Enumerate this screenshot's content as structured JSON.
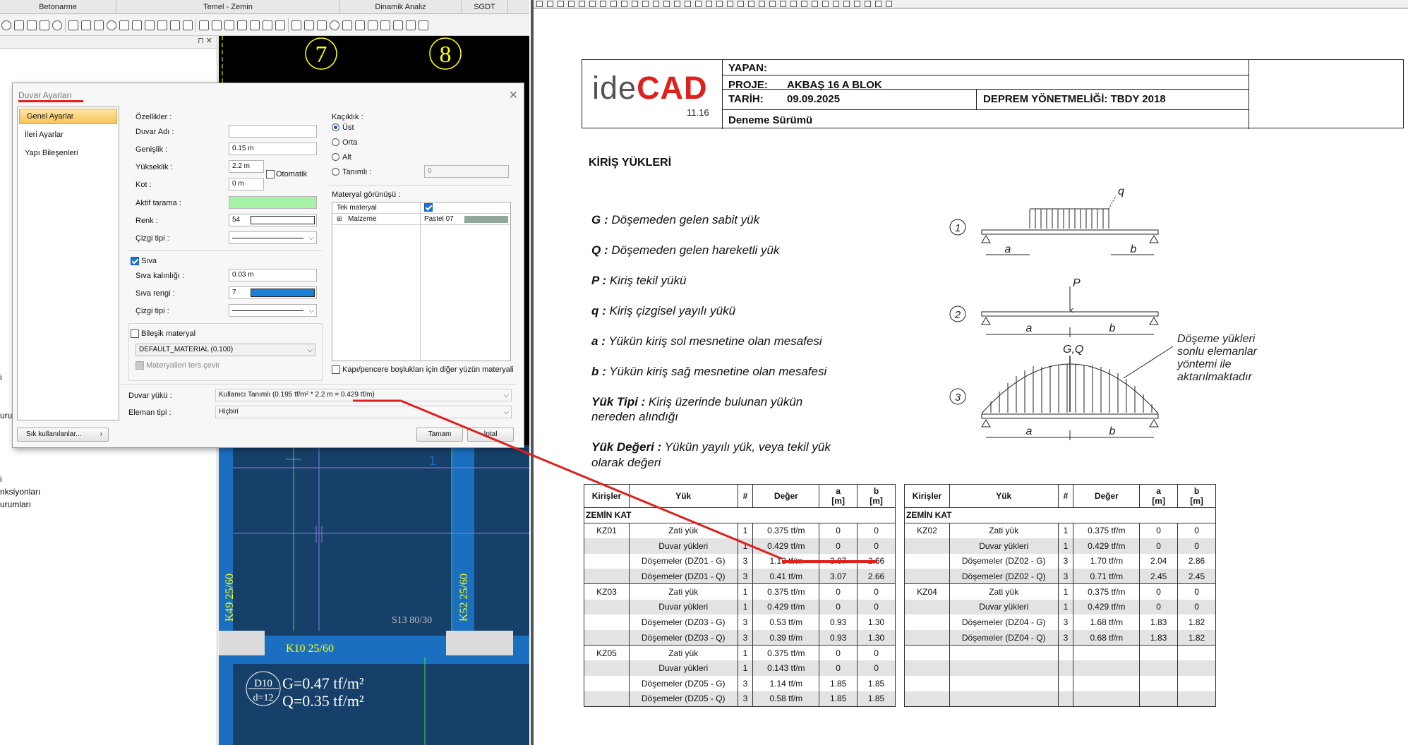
{
  "ribbon": {
    "tabs": [
      "Betonarme",
      "Temel - Zemin",
      "Dinamik Analiz",
      "SGDT"
    ]
  },
  "side_panel": {
    "header_icons": "⊓ ✕",
    "fragments": [
      "i",
      "urun",
      "i",
      "nksiyonları",
      "urumları"
    ]
  },
  "cad": {
    "axis_labels": [
      "7",
      "8"
    ],
    "beam_label": "K10  25/60",
    "column_left_label": "K49  25/60",
    "column_right_label": "K52  25/60",
    "column_label": "S13 80/30",
    "slab_id": "D10",
    "slab_thickness": "d=12",
    "slab_g": "G=0.47 tf/m²",
    "slab_q": "Q=0.35 tf/m²",
    "grid_number": "1"
  },
  "dialog": {
    "title": "Duvar Ayarları",
    "close": "✕",
    "nav": [
      "Genel Ayarlar",
      "İleri Ayarlar",
      "Yapı Bileşenleri"
    ],
    "active_nav": "Genel Ayarlar",
    "ozellikler_label": "Özellikler :",
    "duvar_adi_label": "Duvar Adı :",
    "duvar_adi_value": "",
    "genislik_label": "Genişlik :",
    "genislik_value": "0.15 m",
    "yukseklik_label": "Yükseklik :",
    "yukseklik_value": "2.2 m",
    "otomatik_label": "Otomatik",
    "kot_label": "Kot :",
    "kot_value": "0 m",
    "aktif_tarama_label": "Aktif tarama :",
    "renk_label": "Renk :",
    "renk_value": "54",
    "cizgi_tipi_label": "Çizgi tipi :",
    "siva_label": "Sıva",
    "siva_kalinligi_label": "Sıva kalınlığı :",
    "siva_kalinligi_value": "0.03 m",
    "siva_rengi_label": "Sıva rengi :",
    "siva_rengi_value": "7",
    "siva_cizgi_label": "Çizgi tipi :",
    "bilesik_label": "Bileşik materyal",
    "bilesik_value": "DEFAULT_MATERIAL (0.100)",
    "ters_cevir_label": "Materyalleri ters çevir",
    "kacklik_label": "Kaçıklık :",
    "kacklik_options": [
      "Üst",
      "Orta",
      "Alt",
      "Tanımlı :"
    ],
    "kacklik_selected": "Üst",
    "tanimli_value": "0",
    "materyal_gorunusu_label": "Materyal görünüşü :",
    "tek_materyal_label": "Tek materyal",
    "malzeme_label": "Malzeme",
    "malzeme_value": "Pastel 07",
    "kapi_label": "Kapı/pencere boşlukları için diğer yüzün materyali",
    "duvar_yuku_label": "Duvar yükü :",
    "duvar_yuku_value": "Kullanıcı Tanımlı (0.195 tf/m² * 2.2 m = 0.429 tf/m)",
    "eleman_tipi_label": "Eleman tipi :",
    "eleman_tipi_value": "Hiçbiri",
    "sik_button": "Sık kullanılanlar...",
    "ok_button": "Tamam",
    "cancel_button": "İptal",
    "colors": {
      "aktif_tarama": "#a6f3a6",
      "siva_rengi": "#1a7fd8"
    }
  },
  "report": {
    "logo_ide": "ide",
    "logo_cad": "CAD",
    "logo_version": "11.16",
    "yapan": "YAPAN:",
    "proje_label": "PROJE:",
    "proje_value": "AKBAŞ 16 A  BLOK",
    "tarih_label": "TARİH:",
    "tarih_value": "09.09.2025",
    "deprem": "DEPREM YÖNETMELİĞİ: TBDY 2018",
    "surum": "Deneme Sürümü",
    "section_title": "KİRİŞ YÜKLERİ",
    "legend": [
      {
        "key": "G :",
        "text": " Döşemeden gelen sabit yük"
      },
      {
        "key": "Q :",
        "text": " Döşemeden gelen hareketli yük"
      },
      {
        "key": "P :",
        "text": " Kiriş tekil yükü"
      },
      {
        "key": "q :",
        "text": " Kiriş çizgisel yayılı yükü"
      },
      {
        "key": "a :",
        "text": " Yükün kiriş sol mesnetine olan mesafesi"
      },
      {
        "key": "b :",
        "text": " Yükün kiriş sağ mesnetine olan mesafesi"
      },
      {
        "key": "Yük Tipi :",
        "text": " Kiriş üzerinde bulunan yükün"
      },
      {
        "key": "",
        "text": "nereden alındığı"
      },
      {
        "key": "Yük Değeri :",
        "text": " Yükün yayılı yük, veya tekil yük"
      },
      {
        "key": "",
        "text": "olarak değeri"
      }
    ],
    "diagram": {
      "labels": [
        "q",
        "a",
        "b",
        "P",
        "a",
        "b",
        "G,Q",
        "a",
        "b"
      ],
      "numbers": [
        "1",
        "2",
        "3"
      ],
      "note": [
        "Döşeme yükleri",
        "sonlu elemanlar",
        "yöntemi ile",
        "aktarılmaktadır"
      ]
    },
    "table_headers": [
      "Kirişler",
      "Yük",
      "#",
      "Değer",
      "a",
      "b"
    ],
    "table_units": [
      "",
      "",
      "",
      "",
      "[m]",
      "[m]"
    ],
    "floor": "ZEMİN KAT",
    "left_table": [
      {
        "beam": "KZ01",
        "rows": [
          [
            "Zati yük",
            "1",
            "0.375 tf/m",
            "0",
            "0"
          ],
          [
            "Duvar yükleri",
            "1",
            "0.429 tf/m",
            "0",
            "0"
          ],
          [
            "Döşemeler (DZ01 - G)",
            "3",
            "1.13 tf/m",
            "3.07",
            "2.66"
          ],
          [
            "Döşemeler (DZ01 - Q)",
            "3",
            "0.41 tf/m",
            "3.07",
            "2.66"
          ]
        ]
      },
      {
        "beam": "KZ03",
        "rows": [
          [
            "Zati yük",
            "1",
            "0.375 tf/m",
            "0",
            "0"
          ],
          [
            "Duvar yükleri",
            "1",
            "0.429 tf/m",
            "0",
            "0"
          ],
          [
            "Döşemeler (DZ03 - G)",
            "3",
            "0.53 tf/m",
            "0.93",
            "1.30"
          ],
          [
            "Döşemeler (DZ03 - Q)",
            "3",
            "0.39 tf/m",
            "0.93",
            "1.30"
          ]
        ]
      },
      {
        "beam": "KZ05",
        "rows": [
          [
            "Zati yük",
            "1",
            "0.375 tf/m",
            "0",
            "0"
          ],
          [
            "Duvar yükleri",
            "1",
            "0.143 tf/m",
            "0",
            "0"
          ],
          [
            "Döşemeler (DZ05 - G)",
            "3",
            "1.14 tf/m",
            "1.85",
            "1.85"
          ],
          [
            "Döşemeler (DZ05 - Q)",
            "3",
            "0.58 tf/m",
            "1.85",
            "1.85"
          ]
        ]
      }
    ],
    "right_table": [
      {
        "beam": "KZ02",
        "rows": [
          [
            "Zati yük",
            "1",
            "0.375 tf/m",
            "0",
            "0"
          ],
          [
            "Duvar yükleri",
            "1",
            "0.429 tf/m",
            "0",
            "0"
          ],
          [
            "Döşemeler (DZ02 - G)",
            "3",
            "1.70 tf/m",
            "2.04",
            "2.86"
          ],
          [
            "Döşemeler (DZ02 - Q)",
            "3",
            "0.71 tf/m",
            "2.45",
            "2.45"
          ]
        ]
      },
      {
        "beam": "KZ04",
        "rows": [
          [
            "Zati yük",
            "1",
            "0.375 tf/m",
            "0",
            "0"
          ],
          [
            "Duvar yükleri",
            "1",
            "0.429 tf/m",
            "0",
            "0"
          ],
          [
            "Döşemeler (DZ04 - G)",
            "3",
            "1.68 tf/m",
            "1.83",
            "1.82"
          ],
          [
            "Döşemeler (DZ04 - Q)",
            "3",
            "0.68 tf/m",
            "1.83",
            "1.82"
          ]
        ]
      }
    ]
  }
}
